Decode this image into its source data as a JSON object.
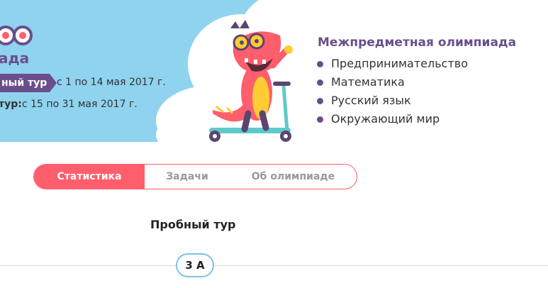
{
  "banner": {
    "olympiad_name_partial": "ада",
    "tour1_badge": "ный тур",
    "tour1_dates": "с 1 по 14 мая 2017 г.",
    "tour2_label": "тур:",
    "tour2_dates": "с 15 по 31 мая 2017 г.",
    "topics_title": "Межпредметная олимпиада",
    "topics": [
      "Предпринимательство",
      "Математика",
      "Русский язык",
      "Окружающий мир"
    ]
  },
  "tabs": [
    {
      "label": "Статистика",
      "active": true
    },
    {
      "label": "Задачи",
      "active": false
    },
    {
      "label": "Об олимпиаде",
      "active": false
    }
  ],
  "section": {
    "title": "Пробный тур",
    "class_label": "3 А"
  },
  "colors": {
    "banner_sky": "#8fd3ef",
    "accent_red": "#ff5e6c",
    "purple": "#6a4e8c",
    "pill_border": "#7cc3e6"
  }
}
